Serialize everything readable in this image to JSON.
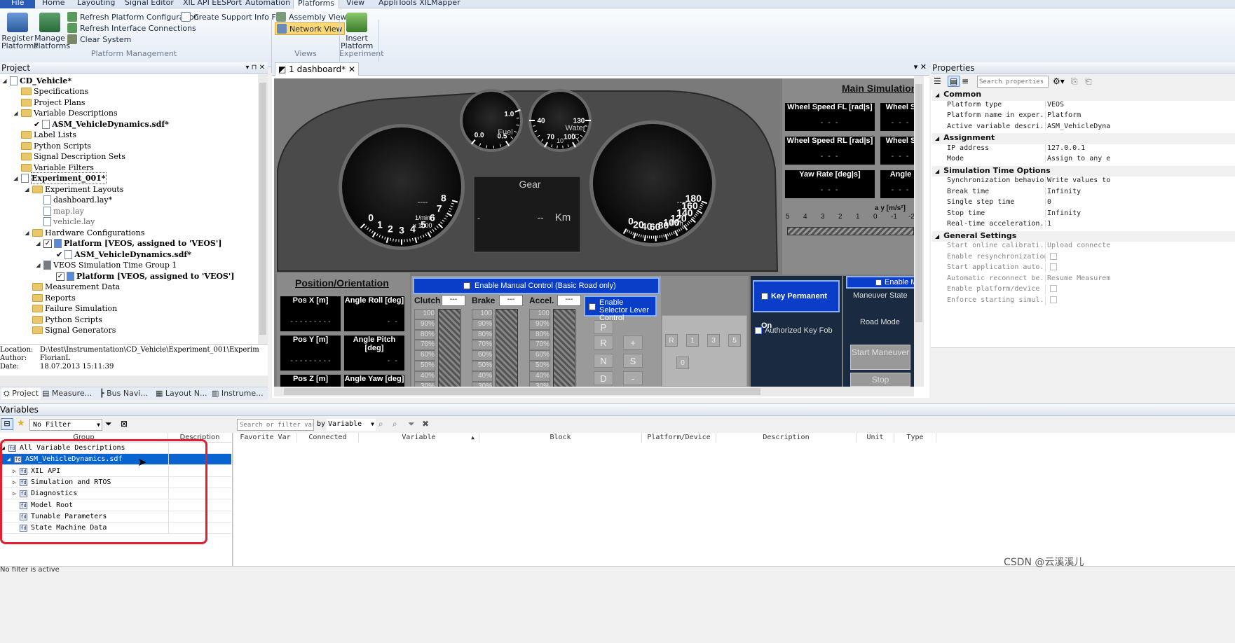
{
  "ribbon": {
    "tabs": [
      "File",
      "Home",
      "Layouting",
      "Signal Editor",
      "XIL API EESPort",
      "Automation",
      "Platforms",
      "View",
      "AppliTools XILMapper"
    ],
    "active_tab": "Platforms",
    "register_platforms": "Register Platforms",
    "manage_platforms": "Manage Platforms",
    "refresh_config": "Refresh Platform Configuration",
    "refresh_interface": "Refresh Interface Connections",
    "clear_system": "Clear System",
    "create_support": "Create Support Info File",
    "group_platform_mgmt": "Platform Management",
    "assembly_view": "Assembly View",
    "network_view": "Network View",
    "group_views": "Views",
    "insert_platform": "Insert Platform",
    "group_experiment": "Experiment"
  },
  "project": {
    "title": "Project",
    "tree": [
      "CD_Vehicle*",
      "Specifications",
      "Project Plans",
      "Variable Descriptions",
      "ASM_VehicleDynamics.sdf*",
      "Label Lists",
      "Python Scripts",
      "Signal Description Sets",
      "Variable Filters",
      "Experiment_001*",
      "Experiment Layouts",
      "dashboard.lay*",
      "map.lay",
      "vehicle.lay",
      "Hardware Configurations",
      "Platform [VEOS, assigned to 'VEOS']",
      "ASM_VehicleDynamics.sdf*",
      "VEOS Simulation Time Group 1",
      "Platform [VEOS, assigned to 'VEOS']",
      "Measurement Data",
      "Reports",
      "Failure Simulation",
      "Python Scripts",
      "Signal Generators"
    ],
    "location_label": "Location:",
    "location_value": "D:\\test\\Instrumentation\\CD_Vehicle\\Experiment_001\\Experiment",
    "author_label": "Author:",
    "author_value": "FlorianL",
    "date_label": "Date:",
    "date_value": "18.07.2013 15:11:39",
    "bottom_tabs": [
      "Project",
      "Measure...",
      "Bus Navi...",
      "Layout N...",
      "Instrume..."
    ]
  },
  "dashboard": {
    "tab_label": "1 dashboard*",
    "rpm_ticks": [
      "0",
      "1",
      "2",
      "3",
      "4",
      "5",
      "6",
      "7",
      "8"
    ],
    "rpm_unit": "1/min",
    "rpm_unit2": "x 1000",
    "rpm_readout": "----",
    "fuel_ticks": [
      "0.0",
      "0.5",
      "1.0"
    ],
    "fuel_label": "Fuel",
    "water_ticks": [
      "40",
      "70",
      "100",
      "130"
    ],
    "water_label": "Water",
    "water_unit": "°C",
    "water_ten": "10",
    "speed_ticks": [
      "0",
      "20",
      "40",
      "60",
      "80",
      "100",
      "120",
      "140",
      "160",
      "180"
    ],
    "speed_unit": "km/h",
    "speed_readout": "----",
    "gear_label": "Gear",
    "gear_value": "--",
    "gear_dash": "-",
    "km_label": "Km",
    "main_sim_title": "Main Simulation",
    "wheel_fl": "Wheel Speed FL [rad|s]",
    "wheel_fr": "Wheel S",
    "wheel_rl": "Wheel Speed RL [rad|s]",
    "wheel_rr": "Wheel S",
    "yaw_rate": "Yaw Rate [deg|s]",
    "angle": "Angle",
    "dash_value": "- - -",
    "ay_label": "a y [m/s²]",
    "ay_ticks": [
      "5",
      "4",
      "3",
      "2",
      "1",
      "0",
      "-1",
      "-2"
    ],
    "pos_title": "Position/Orientation",
    "pos_x": "Pos X [m]",
    "angle_roll": "Angle Roll [deg]",
    "pos_y": "Pos Y [m]",
    "angle_pitch": "Angle Pitch [deg]",
    "pos_z": "Pos Z [m]",
    "angle_yaw": "Angle Yaw [deg]",
    "long_dash": "- - - - - - - - -",
    "short_dash": "- -",
    "enable_manual": "Enable Manual Control (Basic Road only)",
    "clutch": "Clutch",
    "brake": "Brake",
    "accel": "Accel.",
    "pedal_value": "---",
    "pct_scale": [
      "100",
      "90%",
      "80%",
      "70%",
      "60%",
      "50%",
      "40%",
      "30%",
      "20%"
    ],
    "enable_selector": "Enable Selector Lever Control",
    "gears": [
      "P",
      "R",
      "N",
      "D"
    ],
    "plus": "+",
    "s_btn": "S",
    "minus": "-",
    "shift_pattern": [
      "R",
      "1",
      "3",
      "5",
      "0"
    ],
    "key_permanent": "Key Permanent On",
    "authorized_key": "Authorized Key Fob",
    "enable_m": "Enable M",
    "maneuver_state": "Maneuver State",
    "road_mode": "Road Mode",
    "start_maneuver": "Start Maneuver",
    "stop": "Stop"
  },
  "properties": {
    "title": "Properties",
    "search_placeholder": "Search properties",
    "cat_common": "Common",
    "cat_assignment": "Assignment",
    "cat_simtime": "Simulation Time Options",
    "cat_general": "General Settings",
    "rows_common": [
      {
        "k": "Platform type",
        "v": "VEOS"
      },
      {
        "k": "Platform name in exper...",
        "v": "Platform"
      },
      {
        "k": "Active variable descri...",
        "v": "ASM_VehicleDyna"
      }
    ],
    "rows_assignment": [
      {
        "k": "IP address",
        "v": "127.0.0.1"
      },
      {
        "k": "Mode",
        "v": "Assign to any e"
      }
    ],
    "rows_simtime": [
      {
        "k": "Synchronization behavior",
        "v": "Write values to"
      },
      {
        "k": "Break time",
        "v": "Infinity"
      },
      {
        "k": "Single step time",
        "v": "0"
      },
      {
        "k": "Stop time",
        "v": "Infinity"
      },
      {
        "k": "Real-time acceleration...",
        "v": "1"
      }
    ],
    "rows_general": [
      {
        "k": "Start online calibrati...",
        "v": "Upload connecte"
      },
      {
        "k": "Enable resynchronization",
        "v": ""
      },
      {
        "k": "Start application auto...",
        "v": ""
      },
      {
        "k": "Automatic reconnect be...",
        "v": "Resume Measurem"
      },
      {
        "k": "Enable platform/device",
        "v": ""
      },
      {
        "k": "Enforce starting simul...",
        "v": ""
      }
    ]
  },
  "variables": {
    "title": "Variables",
    "filter_value": "No Filter",
    "search_placeholder": "Search or filter varial",
    "by_label": "by",
    "by_value": "Variable",
    "left_cols": [
      "Group",
      "Description"
    ],
    "groups": [
      "All Variable Descriptions",
      "ASM_VehicleDynamics.sdf",
      "XIL API",
      "Simulation and RTOS",
      "Diagnostics",
      "Model Root",
      "Tunable Parameters",
      "State Machine Data"
    ],
    "right_cols": [
      "Favorite Var",
      "Connected",
      "Variable",
      "Block",
      "Platform/Device",
      "Description",
      "Unit",
      "Type"
    ],
    "status": "No filter is active"
  },
  "watermark": "CSDN @云溪溪儿",
  "colors": {
    "accent": "#2a5bb5",
    "dash_blue": "#0a3ec8",
    "highlight_red": "#e02020",
    "selection": "#0a64d0"
  }
}
